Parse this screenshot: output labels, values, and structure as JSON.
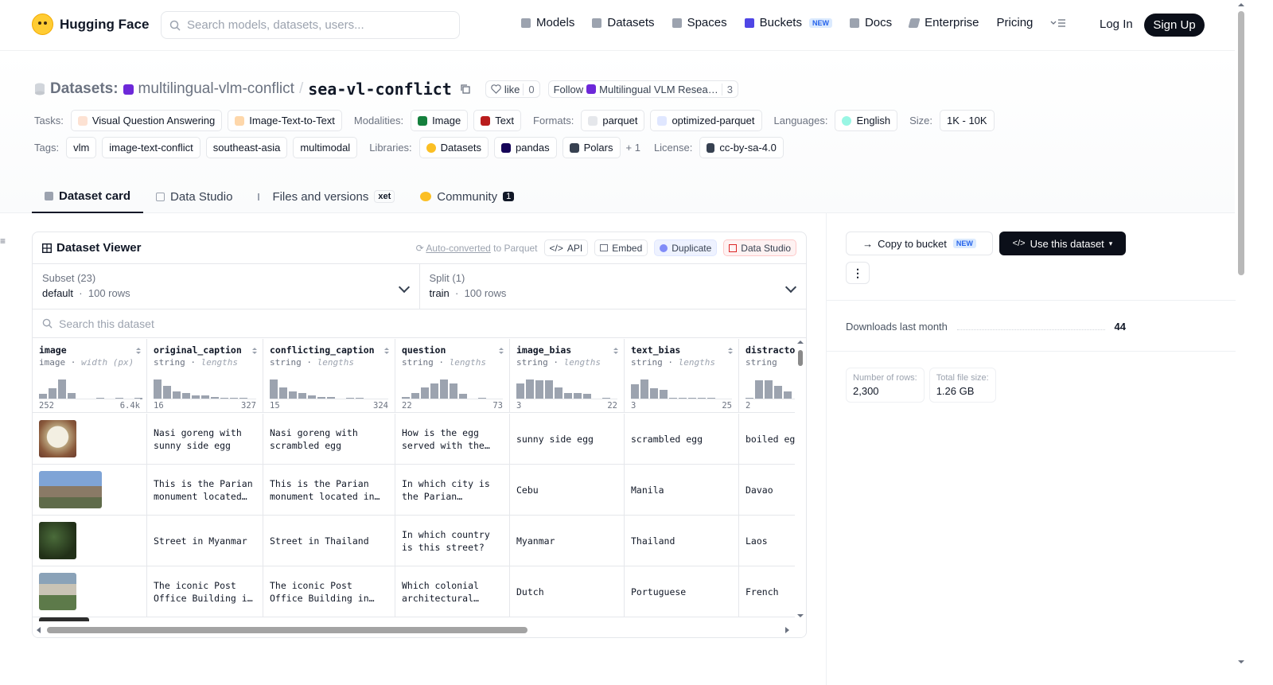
{
  "header": {
    "brand": "Hugging Face",
    "search_placeholder": "Search models, datasets, users...",
    "nav": [
      {
        "label": "Models",
        "icon": "cube-icon"
      },
      {
        "label": "Datasets",
        "icon": "database-icon"
      },
      {
        "label": "Spaces",
        "icon": "grid-icon"
      },
      {
        "label": "Buckets",
        "icon": "bucket-icon",
        "badge": "NEW"
      },
      {
        "label": "Docs",
        "icon": "book-icon"
      },
      {
        "label": "Enterprise",
        "icon": "enterprise-icon"
      },
      {
        "label": "Pricing"
      }
    ],
    "login": "Log In",
    "signup": "Sign Up"
  },
  "repo": {
    "section": "Datasets:",
    "owner": "multilingual-vlm-conflict",
    "slash": "/",
    "name": "sea-vl-conflict",
    "like_label": "like",
    "like_count": "0",
    "follow_label": "Follow",
    "follow_org": "Multilingual VLM Resea…",
    "follow_count": "3"
  },
  "tags_row1": {
    "tasks_label": "Tasks:",
    "tasks": [
      "Visual Question Answering",
      "Image-Text-to-Text"
    ],
    "modalities_label": "Modalities:",
    "modalities": [
      "Image",
      "Text"
    ],
    "formats_label": "Formats:",
    "formats": [
      "parquet",
      "optimized-parquet"
    ],
    "languages_label": "Languages:",
    "languages": [
      "English"
    ],
    "size_label": "Size:",
    "size": "1K - 10K"
  },
  "tags_row2": {
    "tags_label": "Tags:",
    "tags": [
      "vlm",
      "image-text-conflict",
      "southeast-asia",
      "multimodal"
    ],
    "libraries_label": "Libraries:",
    "libraries": [
      "Datasets",
      "pandas",
      "Polars"
    ],
    "more": "+ 1",
    "license_label": "License:",
    "license": "cc-by-sa-4.0"
  },
  "tabs": [
    {
      "label": "Dataset card",
      "active": true
    },
    {
      "label": "Data Studio"
    },
    {
      "label": "Files and versions",
      "badge": "xet"
    },
    {
      "label": "Community",
      "count": "1"
    }
  ],
  "viewer": {
    "title": "Dataset Viewer",
    "auto_converted": "Auto-converted",
    "auto_suffix": " to Parquet",
    "buttons": [
      "API",
      "Embed",
      "Duplicate",
      "Data Studio"
    ],
    "subset_label": "Subset (23)",
    "subset_value": "default",
    "subset_rows": "100 rows",
    "split_label": "Split (1)",
    "split_value": "train",
    "split_rows": "100 rows",
    "search_placeholder": "Search this dataset",
    "columns": [
      {
        "name": "image",
        "type": "image",
        "stat": "width (px)",
        "min": "252",
        "max": "6.4k",
        "hist": [
          0.2,
          0.4,
          0.75,
          0.25,
          0,
          0,
          0.05,
          0,
          0.05,
          0,
          0.05
        ]
      },
      {
        "name": "original_caption",
        "type": "string",
        "stat": "lengths",
        "min": "16",
        "max": "327",
        "hist": [
          0.75,
          0.5,
          0.3,
          0.25,
          0.15,
          0.15,
          0.1,
          0.05,
          0.05,
          0.05
        ]
      },
      {
        "name": "conflicting_caption",
        "type": "string",
        "stat": "lengths",
        "min": "15",
        "max": "324",
        "hist": [
          0.75,
          0.45,
          0.3,
          0.25,
          0.15,
          0.1,
          0.1,
          0,
          0.05,
          0.05
        ]
      },
      {
        "name": "question",
        "type": "string",
        "stat": "lengths",
        "min": "22",
        "max": "73",
        "hist": [
          0.1,
          0.25,
          0.45,
          0.6,
          0.75,
          0.6,
          0.2,
          0,
          0.05
        ]
      },
      {
        "name": "image_bias",
        "type": "string",
        "stat": "lengths",
        "min": "3",
        "max": "22",
        "hist": [
          0.6,
          0.75,
          0.7,
          0.7,
          0.45,
          0.25,
          0.25,
          0.2,
          0,
          0.05
        ]
      },
      {
        "name": "text_bias",
        "type": "string",
        "stat": "lengths",
        "min": "3",
        "max": "25",
        "hist": [
          0.55,
          0.75,
          0.4,
          0.35,
          0.05,
          0.05,
          0.05,
          0.05,
          0.05
        ]
      },
      {
        "name": "distracto",
        "type": "string",
        "stat": "",
        "min": "2",
        "max": "",
        "hist": [
          0.05,
          0.7,
          0.7,
          0.5,
          0.3
        ]
      }
    ],
    "rows": [
      {
        "original_caption": "Nasi goreng with sunny side egg",
        "conflicting_caption": "Nasi goreng with scrambled egg",
        "question": "How is the egg served with the…",
        "image_bias": "sunny side egg",
        "text_bias": "scrambled egg",
        "distractor": "boiled eg"
      },
      {
        "original_caption": "This is the Parian monument located…",
        "conflicting_caption": "This is the Parian monument located in…",
        "question": "In which city is the Parian…",
        "image_bias": "Cebu",
        "text_bias": "Manila",
        "distractor": "Davao"
      },
      {
        "original_caption": "Street in Myanmar",
        "conflicting_caption": "Street in Thailand",
        "question": "In which country is this street?",
        "image_bias": "Myanmar",
        "text_bias": "Thailand",
        "distractor": "Laos"
      },
      {
        "original_caption": "The iconic Post Office Building i…",
        "conflicting_caption": "The iconic Post Office Building in…",
        "question": "Which colonial architectural…",
        "image_bias": "Dutch",
        "text_bias": "Portuguese",
        "distractor": "French"
      }
    ]
  },
  "sidebar": {
    "copy_label": "Copy to bucket",
    "copy_badge": "NEW",
    "use_label": "Use this dataset",
    "downloads_label": "Downloads last month",
    "downloads_value": "44",
    "rows_label": "Number of rows:",
    "rows_value": "2,300",
    "size_label": "Total file size:",
    "size_value": "1.26 GB"
  }
}
